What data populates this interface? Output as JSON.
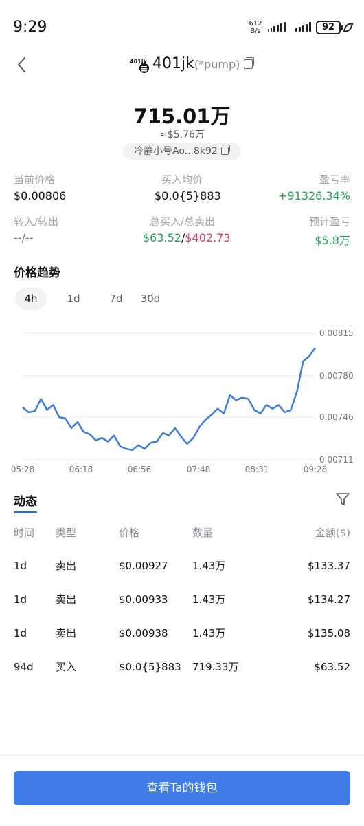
{
  "status_bar": {
    "time": "9:29",
    "net_speed_value": "612",
    "net_speed_unit": "B/s",
    "battery": "92"
  },
  "header": {
    "logo_text": "401jk",
    "token_name": "401jk",
    "token_tag": "(*pump)"
  },
  "balance": {
    "amount": "715.01万",
    "usd": "≈$5.76万",
    "wallet": "冷静小号Ao...8k92"
  },
  "stats": {
    "current_price_label": "当前价格",
    "current_price": "$0.00806",
    "avg_buy_label": "买入均价",
    "avg_buy": "$0.0{5}883",
    "pnl_rate_label": "盈亏率",
    "pnl_rate": "+91326.34%",
    "transfer_label": "转入/转出",
    "transfer": "--/--",
    "total_label": "总买入/总卖出",
    "total_buy": "$63.52",
    "total_sep": "/",
    "total_sell": "$402.73",
    "est_pnl_label": "预计盈亏",
    "est_pnl": "$5.8万"
  },
  "trend": {
    "title": "价格趋势",
    "tabs": [
      "4h",
      "1d",
      "7d",
      "30d"
    ],
    "active_tab": "4h"
  },
  "chart_data": {
    "type": "line",
    "x_ticks": [
      "05:28",
      "06:18",
      "06:56",
      "07:48",
      "08:31",
      "09:28"
    ],
    "y_ticks": [
      "0.00815",
      "0.00780",
      "0.00746",
      "0.00711"
    ],
    "ylim": [
      0.00711,
      0.00815
    ],
    "line_color": "#3b7ddd",
    "x": [
      "05:28",
      "05:33",
      "05:38",
      "05:43",
      "05:48",
      "05:53",
      "05:58",
      "06:03",
      "06:08",
      "06:13",
      "06:18",
      "06:23",
      "06:28",
      "06:33",
      "06:38",
      "06:43",
      "06:48",
      "06:53",
      "06:58",
      "07:03",
      "07:08",
      "07:13",
      "07:18",
      "07:23",
      "07:28",
      "07:33",
      "07:38",
      "07:43",
      "07:48",
      "07:53",
      "07:58",
      "08:03",
      "08:08",
      "08:13",
      "08:18",
      "08:23",
      "08:28",
      "08:33",
      "08:38",
      "08:43",
      "08:48",
      "08:53",
      "08:58",
      "09:03",
      "09:08",
      "09:13",
      "09:18",
      "09:23",
      "09:28"
    ],
    "values": [
      0.00754,
      0.0075,
      0.00751,
      0.00761,
      0.00752,
      0.00756,
      0.00746,
      0.00745,
      0.00737,
      0.00742,
      0.00734,
      0.00732,
      0.00727,
      0.00729,
      0.00726,
      0.00731,
      0.00722,
      0.0072,
      0.00719,
      0.00723,
      0.0072,
      0.00725,
      0.00726,
      0.00733,
      0.00731,
      0.00737,
      0.0073,
      0.00724,
      0.00729,
      0.00738,
      0.00744,
      0.00748,
      0.00753,
      0.00749,
      0.00764,
      0.0076,
      0.00762,
      0.00761,
      0.00752,
      0.00749,
      0.00756,
      0.00753,
      0.00756,
      0.0075,
      0.00752,
      0.00767,
      0.00792,
      0.00796,
      0.00803
    ]
  },
  "activity": {
    "title": "动态",
    "columns": [
      "时间",
      "类型",
      "价格",
      "数量",
      "金额($)"
    ],
    "rows": [
      {
        "time": "1d",
        "type": "卖出",
        "price": "$0.00927",
        "qty": "1.43万",
        "amount": "$133.37"
      },
      {
        "time": "1d",
        "type": "卖出",
        "price": "$0.00933",
        "qty": "1.43万",
        "amount": "$134.27"
      },
      {
        "time": "1d",
        "type": "卖出",
        "price": "$0.00938",
        "qty": "1.43万",
        "amount": "$135.08"
      },
      {
        "time": "94d",
        "type": "买入",
        "price": "$0.0{5}883",
        "qty": "719.33万",
        "amount": "$63.52"
      }
    ]
  },
  "button": {
    "label": "查看Ta的钱包"
  }
}
